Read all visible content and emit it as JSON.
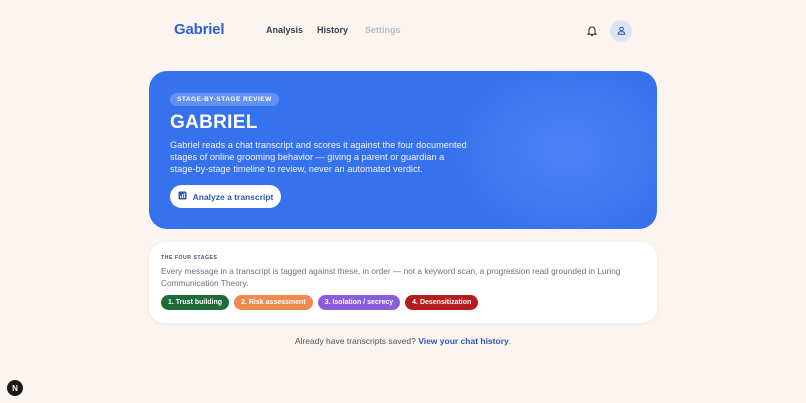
{
  "header": {
    "brand": "Gabriel",
    "nav": {
      "analysis": "Analysis",
      "history": "History",
      "settings": "Settings"
    }
  },
  "hero": {
    "pill": "STAGE-BY-STAGE REVIEW",
    "title": "GABRIEL",
    "description": "Gabriel reads a chat transcript and scores it against the four documented stages of online grooming behavior — giving a parent or guardian a stage-by-stage timeline to review, never an automated verdict.",
    "cta_label": "Analyze a transcript"
  },
  "stages_card": {
    "label": "THE FOUR STAGES",
    "description": "Every message in a transcript is tagged against these, in order — not a keyword scan, a progression read grounded in Luring Communication Theory.",
    "chips": [
      {
        "label": "1. Trust building",
        "color": "#1f6b3a"
      },
      {
        "label": "2. Risk assessment",
        "color": "#f0894d"
      },
      {
        "label": "3. Isolation / secrecy",
        "color": "#8a5ce0"
      },
      {
        "label": "4. Desensitization",
        "color": "#b31d1d"
      }
    ]
  },
  "footer": {
    "text": "Already have transcripts saved?",
    "link": "View your chat history",
    "period": "."
  },
  "corner_badge": "N",
  "colors": {
    "background": "#fcf5ef",
    "hero": "#3672ee",
    "brand": "#2f5fd6"
  }
}
